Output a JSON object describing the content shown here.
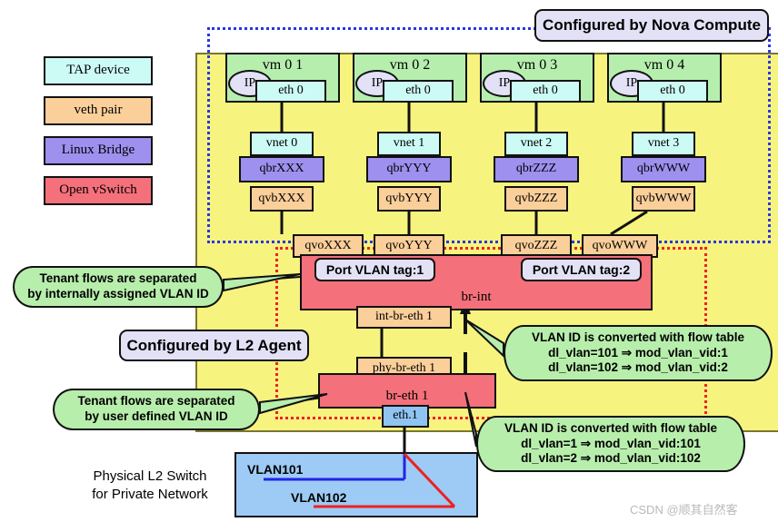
{
  "legend": {
    "items": [
      {
        "label": "TAP   device",
        "color": "#ccfbf6"
      },
      {
        "label": "veth   pair",
        "color": "#fbcf9a"
      },
      {
        "label": "Linux   Bridge",
        "color": "#9d90ee"
      },
      {
        "label": "Open   vSwitch",
        "color": "#f4707a"
      }
    ]
  },
  "annotations": {
    "nova": "Configured by Nova Compute",
    "l2agent": "Configured by L2 Agent"
  },
  "vms": [
    {
      "title": "vm 0 1",
      "ip": "IP",
      "eth": "eth 0",
      "vnet": "vnet 0",
      "qbr": "qbrXXX",
      "qvb": "qvbXXX",
      "qvo": "qvoXXX"
    },
    {
      "title": "vm 0 2",
      "ip": "IP",
      "eth": "eth 0",
      "vnet": "vnet 1",
      "qbr": "qbrYYY",
      "qvb": "qvbYYY",
      "qvo": "qvoYYY"
    },
    {
      "title": "vm 0 3",
      "ip": "IP",
      "eth": "eth 0",
      "vnet": "vnet 2",
      "qbr": "qbrZZZ",
      "qvb": "qvbZZZ",
      "qvo": "qvoZZZ"
    },
    {
      "title": "vm 0 4",
      "ip": "IP",
      "eth": "eth 0",
      "vnet": "vnet 3",
      "qbr": "qbrWWW",
      "qvb": "qvbWWW",
      "qvo": "qvoWWW"
    }
  ],
  "bridges": {
    "br_int": "br-int",
    "port_vlan_tag_1": "Port VLAN tag:1",
    "port_vlan_tag_2": "Port VLAN tag:2",
    "int_br_eth1": "int-br-eth 1",
    "phy_br_eth1": "phy-br-eth 1",
    "br_eth1": "br-eth 1",
    "eth1": "eth.1"
  },
  "callouts": {
    "tenant_internal": [
      "Tenant flows are separated",
      "by internally assigned VLAN ID"
    ],
    "tenant_user": [
      "Tenant flows are separated",
      "by user defined VLAN ID"
    ],
    "flow_up": [
      "VLAN ID is converted with flow table",
      "dl_vlan=101 ⇒ mod_vlan_vid:1",
      "dl_vlan=102 ⇒ mod_vlan_vid:2"
    ],
    "flow_down": [
      "VLAN ID is converted with flow table",
      "dl_vlan=1 ⇒ mod_vlan_vid:101",
      "dl_vlan=2 ⇒ mod_vlan_vid:102"
    ]
  },
  "switch": {
    "title_line1": "Physical L2 Switch",
    "title_line2": "for Private Network",
    "vlan101": "VLAN101",
    "vlan102": "VLAN102",
    "vlan101_color": "#2323e8",
    "vlan102_color": "#ee2020"
  },
  "watermark": "CSDN @顺其自然客"
}
